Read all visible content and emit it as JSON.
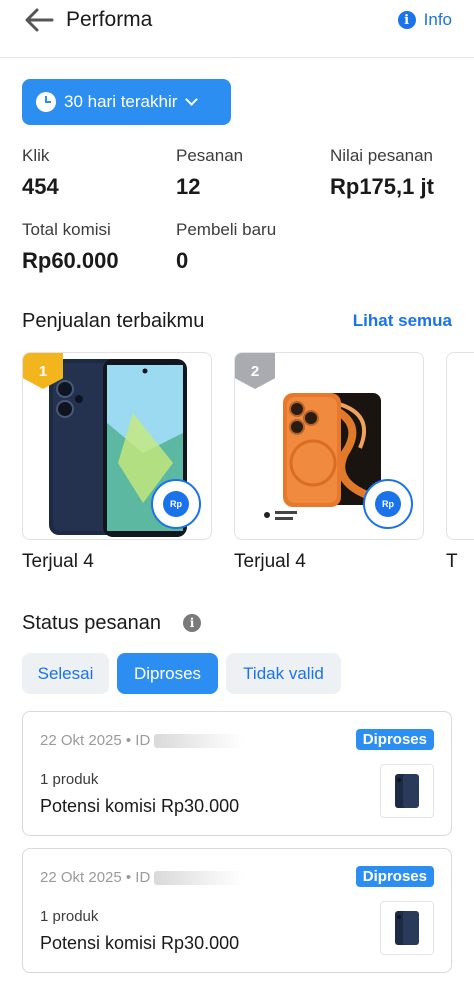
{
  "header": {
    "title": "Performa",
    "info_label": "Info"
  },
  "date_filter": {
    "label": "30 hari terakhir"
  },
  "stats": [
    {
      "label": "Klik",
      "value": "454"
    },
    {
      "label": "Pesanan",
      "value": "12"
    },
    {
      "label": "Nilai pesanan",
      "value": "Rp175,1 jt"
    },
    {
      "label": "Total komisi",
      "value": "Rp60.000"
    },
    {
      "label": "Pembeli baru",
      "value": "0"
    }
  ],
  "best_sellers": {
    "title": "Penjualan terbaikmu",
    "see_all": "Lihat semua",
    "items": [
      {
        "rank": "1",
        "sold": "Terjual 4",
        "rank_color": "#f2b51d"
      },
      {
        "rank": "2",
        "sold": "Terjual 4",
        "rank_color": "#a8acb0"
      }
    ],
    "partial_sold": "T"
  },
  "order_status": {
    "title": "Status pesanan",
    "tabs": [
      {
        "label": "Selesai",
        "active": false
      },
      {
        "label": "Diproses",
        "active": true
      },
      {
        "label": "Tidak valid",
        "active": false
      }
    ],
    "orders": [
      {
        "date_id": "22 Okt 2025 • ID",
        "status": "Diproses",
        "count": "1 produk",
        "commission": "Potensi komisi Rp30.000"
      },
      {
        "date_id": "22 Okt 2025 • ID",
        "status": "Diproses",
        "count": "1 produk",
        "commission": "Potensi komisi Rp30.000"
      }
    ]
  },
  "icons": {
    "back": "arrow-left-icon",
    "info": "info-icon",
    "clock": "clock-icon",
    "share": "share-icon"
  },
  "colors": {
    "accent": "#2b8ef0",
    "link": "#1a73e8"
  }
}
